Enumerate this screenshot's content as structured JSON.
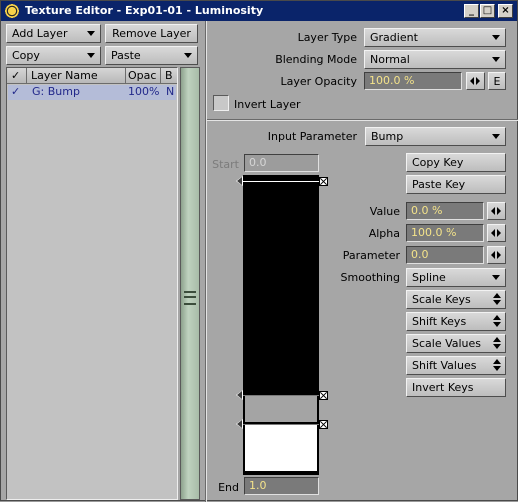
{
  "window": {
    "title": "Texture Editor - Exp01-01 - Luminosity",
    "controls": {
      "minimize": "_",
      "maximize": "□",
      "close": "×"
    }
  },
  "left": {
    "add_layer": "Add Layer",
    "remove_layer": "Remove Layer",
    "copy": "Copy",
    "paste": "Paste",
    "list_headers": {
      "check": "✓",
      "name": "Layer Name",
      "opac": "Opac",
      "blend": "B"
    },
    "rows": [
      {
        "check": "✓",
        "name": "G: Bump",
        "opac": "100%",
        "blend": "N"
      }
    ]
  },
  "layer": {
    "type_label": "Layer Type",
    "type_value": "Gradient",
    "blend_label": "Blending Mode",
    "blend_value": "Normal",
    "opacity_label": "Layer Opacity",
    "opacity_value": "100.0 %",
    "envelope": "E",
    "invert_label": "Invert Layer"
  },
  "gradient": {
    "input_label": "Input Parameter",
    "input_value": "Bump",
    "start_label": "Start",
    "start_value": "0.0",
    "end_label": "End",
    "end_value": "1.0",
    "copy_key": "Copy Key",
    "paste_key": "Paste Key",
    "value_label": "Value",
    "value_value": "0.0 %",
    "alpha_label": "Alpha",
    "alpha_value": "100.0 %",
    "param_label": "Parameter",
    "param_value": "0.0",
    "smoothing_label": "Smoothing",
    "smoothing_value": "Spline",
    "scale_keys": "Scale Keys",
    "shift_keys": "Shift Keys",
    "scale_values": "Scale Values",
    "shift_values": "Shift Values",
    "invert_keys": "Invert Keys",
    "key_fills": [
      "#000000",
      "#a4a4a4",
      "#ffffff"
    ]
  }
}
